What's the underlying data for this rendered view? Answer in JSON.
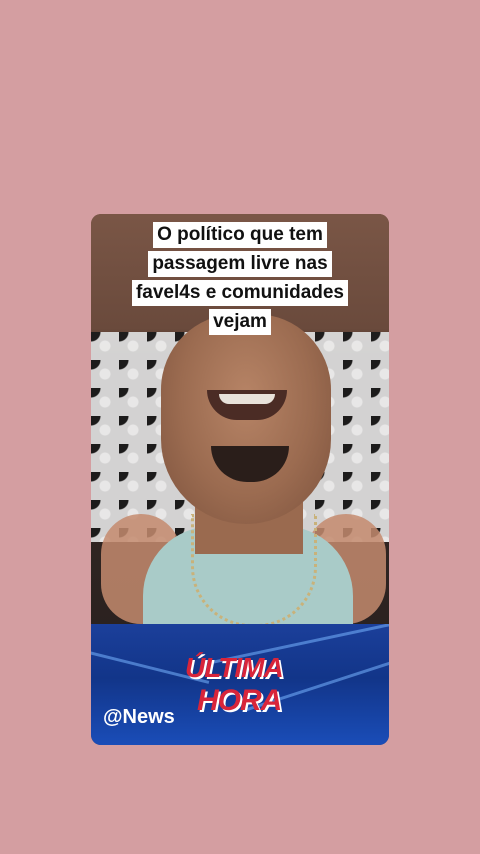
{
  "post": {
    "caption": "O político que tem passagem livre nas favel4s e comunidades vejam"
  },
  "banner": {
    "handle": "@News",
    "logo_word1": "ÚLTIMA",
    "logo_word2": "HORA"
  },
  "colors": {
    "page_background": "#d49ea1",
    "banner_blue": "#123589",
    "logo_red": "#d8253a"
  }
}
